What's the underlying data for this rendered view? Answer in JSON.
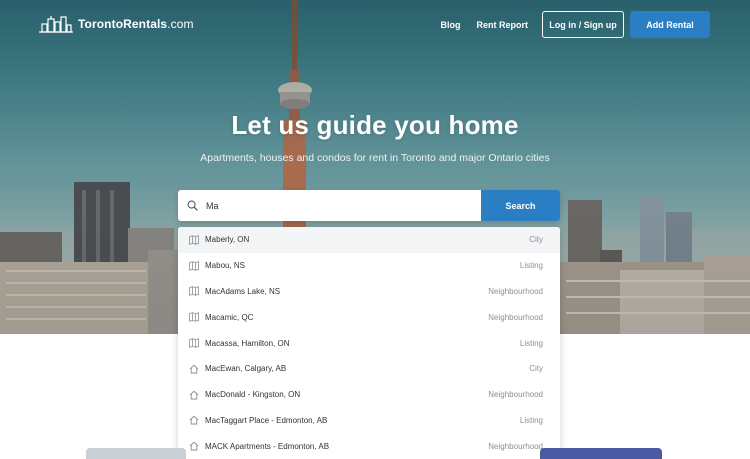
{
  "brand": {
    "name": "TorontoRentals",
    "domain": ".com"
  },
  "nav": {
    "blog": "Blog",
    "rent_report": "Rent Report",
    "login": "Log in / Sign up",
    "add_rental": "Add Rental"
  },
  "hero": {
    "title": "Let us guide you home",
    "subtitle": "Apartments, houses and condos for rent in Toronto and major Ontario cities"
  },
  "search": {
    "value": "Ma",
    "button": "Search"
  },
  "suggestions": [
    {
      "name": "Maberly, ON",
      "type": "City",
      "icon": "map-icon"
    },
    {
      "name": "Mabou, NS",
      "type": "Listing",
      "icon": "map-icon"
    },
    {
      "name": "MacAdams Lake, NS",
      "type": "Neighbourhood",
      "icon": "map-icon"
    },
    {
      "name": "Macamic, QC",
      "type": "Neighbourhood",
      "icon": "map-icon"
    },
    {
      "name": "Macassa, Hamilton, ON",
      "type": "Listing",
      "icon": "map-icon"
    },
    {
      "name": "MacEwan, Calgary, AB",
      "type": "City",
      "icon": "home-icon"
    },
    {
      "name": "MacDonald - Kingston, ON",
      "type": "Neighbourhood",
      "icon": "home-icon"
    },
    {
      "name": "MacTaggart Place - Edmonton, AB",
      "type": "Listing",
      "icon": "home-icon"
    },
    {
      "name": "MACK Apartments - Edmonton, AB",
      "type": "Neighbourhood",
      "icon": "home-icon"
    }
  ],
  "colors": {
    "accent": "#2a7fc4",
    "hero_sky": "#4c8a92",
    "card_purple": "#4c59a3"
  }
}
